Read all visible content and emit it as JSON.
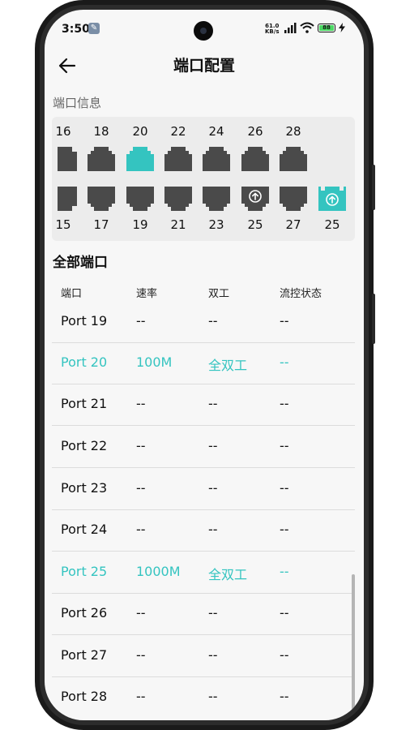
{
  "status_bar": {
    "time": "3:50",
    "net_speed_value": "61.0",
    "net_speed_unit": "KB/s",
    "battery": "88"
  },
  "header": {
    "title": "端口配置"
  },
  "port_info": {
    "label": "端口信息",
    "top_numbers": [
      "16",
      "18",
      "20",
      "22",
      "24",
      "26",
      "28"
    ],
    "bottom_numbers": [
      "15",
      "17",
      "19",
      "21",
      "23",
      "25",
      "27",
      "25"
    ]
  },
  "all_ports": {
    "title": "全部端口",
    "columns": [
      "端口",
      "速率",
      "双工",
      "流控状态"
    ],
    "rows": [
      {
        "port": "Port 19",
        "rate": "--",
        "duplex": "--",
        "flow": "--"
      },
      {
        "port": "Port 20",
        "rate": "100M",
        "duplex": "全双工",
        "flow": "--"
      },
      {
        "port": "Port 21",
        "rate": "--",
        "duplex": "--",
        "flow": "--"
      },
      {
        "port": "Port 22",
        "rate": "--",
        "duplex": "--",
        "flow": "--"
      },
      {
        "port": "Port 23",
        "rate": "--",
        "duplex": "--",
        "flow": "--"
      },
      {
        "port": "Port 24",
        "rate": "--",
        "duplex": "--",
        "flow": "--"
      },
      {
        "port": "Port 25",
        "rate": "1000M",
        "duplex": "全双工",
        "flow": "--"
      },
      {
        "port": "Port 26",
        "rate": "--",
        "duplex": "--",
        "flow": "--"
      },
      {
        "port": "Port 27",
        "rate": "--",
        "duplex": "--",
        "flow": "--"
      },
      {
        "port": "Port 28",
        "rate": "--",
        "duplex": "--",
        "flow": "--"
      }
    ]
  },
  "colors": {
    "accent": "#34c4c0",
    "port_inactive": "#4a4a4a"
  }
}
